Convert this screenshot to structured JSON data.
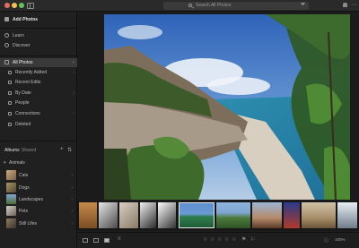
{
  "titlebar": {
    "search_placeholder": "Search All Photos"
  },
  "sidebar": {
    "add_photos": "Add Photos",
    "learn": "Learn",
    "discover": "Discover",
    "all_photos": "All Photos",
    "sub_items": [
      {
        "label": "Recently Added"
      },
      {
        "label": "Recent Edits"
      },
      {
        "label": "By Date"
      },
      {
        "label": "People"
      },
      {
        "label": "Connections"
      },
      {
        "label": "Deleted"
      }
    ],
    "albums_tab": "Albums",
    "shared_tab": "Shared",
    "group": "Animals",
    "albums": [
      {
        "label": "Cats",
        "color": "#b89a7a"
      },
      {
        "label": "Dogs",
        "color": "#9a8b6a"
      },
      {
        "label": "Landscapes",
        "color": "#6f8fb0"
      },
      {
        "label": "Pets",
        "color": "#8a7d70"
      },
      {
        "label": "Still Lifes",
        "color": "#7a6a58"
      }
    ]
  },
  "toolbar": {
    "fit_label": "100%",
    "rating_stars": 5
  },
  "colors": {
    "accent": "#e6e6e6",
    "sidebar_bg": "#202020",
    "selected_bg": "#3a3a3a"
  }
}
